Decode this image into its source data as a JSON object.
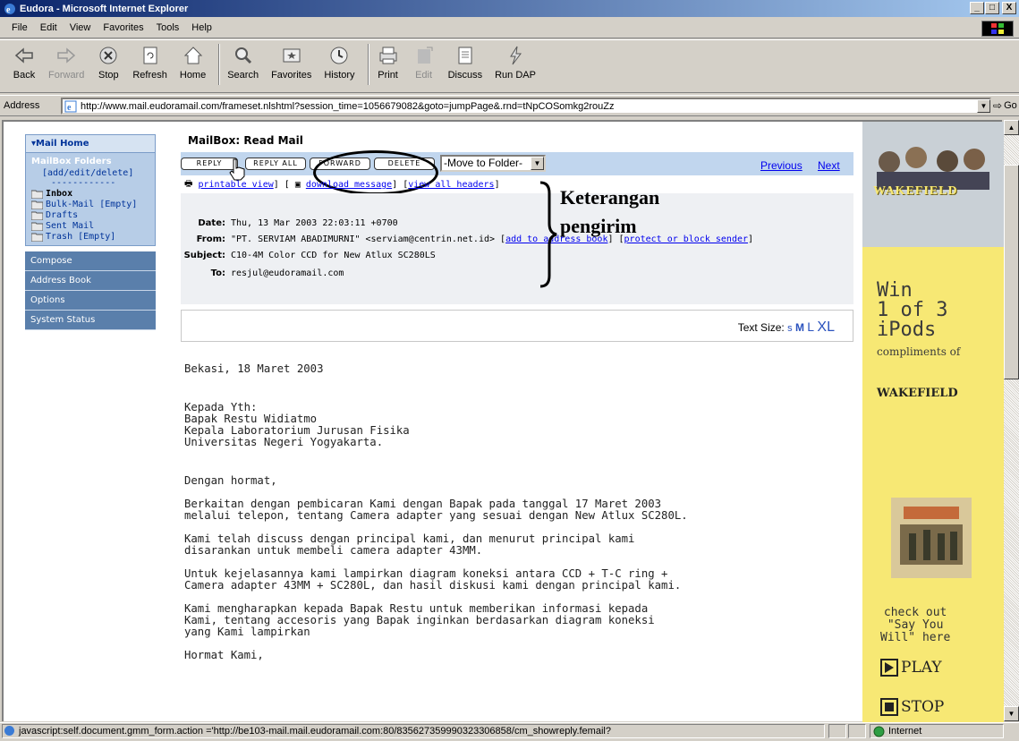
{
  "window": {
    "title": "Eudora - Microsoft Internet Explorer",
    "min": "_",
    "max": "□",
    "close": "X"
  },
  "menu": [
    "File",
    "Edit",
    "View",
    "Favorites",
    "Tools",
    "Help"
  ],
  "toolbar": {
    "back": "Back",
    "forward": "Forward",
    "stop": "Stop",
    "refresh": "Refresh",
    "home": "Home",
    "search": "Search",
    "favorites": "Favorites",
    "history": "History",
    "print": "Print",
    "edit": "Edit",
    "discuss": "Discuss",
    "rundap": "Run DAP"
  },
  "address": {
    "label": "Address",
    "url": "http://www.mail.eudoramail.com/frameset.nlshtml?session_time=1056679082&goto=jumpPage&.rnd=tNpCOSomkg2rouZz",
    "go": "Go"
  },
  "sidebar": {
    "mail_home": "Mail Home",
    "folders_title": "MailBox Folders",
    "add_edit_delete": "[add/edit/delete]",
    "separator": "------------",
    "folders": [
      "Inbox",
      "Bulk-Mail [Empty]",
      "Drafts",
      "Sent Mail",
      "Trash [Empty]"
    ],
    "nav": [
      "Compose",
      "Address Book",
      "Options",
      "System Status"
    ]
  },
  "mail": {
    "title": "MailBox: Read Mail",
    "buttons": {
      "reply": "REPLY",
      "reply_all": "REPLY ALL",
      "forward": "FORWARD",
      "delete": "DELETE"
    },
    "move_to_folder": "-Move to Folder-",
    "previous": "Previous",
    "next": "Next",
    "links": {
      "printable": "printable view",
      "download": "download message",
      "headers": "view all headers"
    },
    "headers": {
      "date_label": "Date:",
      "date": "Thu, 13 Mar 2003 22:03:11 +0700",
      "from_label": "From:",
      "from": "\"PT. SERVIAM ABADIMURNI\" <serviam@centrin.net.id>",
      "add_book": "add to address book",
      "protect": "protect or block sender",
      "subject_label": "Subject:",
      "subject": "C10-4M Color CCD  for New Atlux SC280LS",
      "to_label": "To:",
      "to": "resjul@eudoramail.com"
    },
    "annotation": [
      "Keterangan",
      "pengirim"
    ],
    "text_size_label": "Text Size:",
    "text_sizes": [
      "s",
      "M",
      "L",
      "XL"
    ],
    "body": [
      "Bekasi, 18 Maret 2003",
      "Kepada Yth:\nBapak Restu Widiatmo\nKepala Laboratorium Jurusan Fisika\nUniversitas Negeri Yogyakarta.",
      "Dengan hormat,",
      "Berkaitan dengan pembicaran Kami dengan Bapak pada tanggal 17 Maret 2003\nmelalui telepon, tentang Camera adapter yang sesuai dengan New Atlux SC280L.",
      "Kami telah discuss dengan principal kami, dan menurut principal kami\ndisarankan untuk membeli camera adapter 43MM.",
      "Untuk kejelasannya kami lampirkan diagram koneksi antara CCD + T-C ring +\nCamera adapter 43MM + SC280L, dan hasil diskusi kami dengan principal kami.",
      "Kami mengharapkan kepada Bapak Restu untuk memberikan informasi kepada\nKami, tentang accesoris yang Bapak inginkan berdasarkan diagram koneksi\nyang Kami lampirkan",
      "Hormat Kami,"
    ]
  },
  "ad": {
    "brand_logo": "WAKEFIELD",
    "win": "Win",
    "of": "1 of 3",
    "ipods": "iPods",
    "compliments": "compliments of",
    "brand": "WAKEFIELD",
    "promo": "check out\n\"Say You\nWill\" here",
    "play": "PLAY",
    "stop": "STOP"
  },
  "status": {
    "text": "javascript:self.document.gmm_form.action ='http://be103-mail.mail.eudoramail.com:80/835627359990323306858/cm_showreply.femail?",
    "zone": "Internet"
  }
}
